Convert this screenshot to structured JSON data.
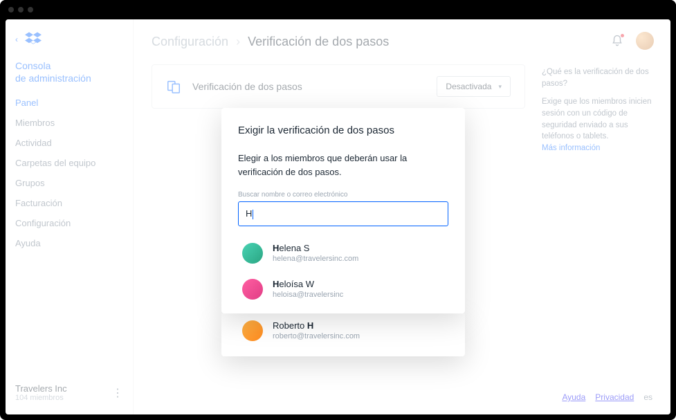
{
  "sidebar": {
    "console_heading_l1": "Consola",
    "console_heading_l2": "de administración",
    "items": [
      "Panel",
      "Miembros",
      "Actividad",
      "Carpetas del equipo",
      "Grupos",
      "Facturación",
      "Configuración",
      "Ayuda"
    ],
    "org_name": "Travelers Inc",
    "org_subtitle": "104 miembros"
  },
  "breadcrumb": {
    "parent": "Configuración",
    "current": "Verificación de dos pasos"
  },
  "card": {
    "title": "Verificación de dos pasos",
    "pill": "Desactivada"
  },
  "info": {
    "question": "¿Qué es la verificación de dos pasos?",
    "body": "Exige que los miembros inicien sesión con un código de seguridad enviado a sus teléfonos o tablets.",
    "link": "Más información"
  },
  "footer": {
    "help": "Ayuda",
    "privacy": "Privacidad",
    "lang": "es"
  },
  "modal": {
    "title": "Exigir la verificación de dos pasos",
    "desc": "Elegir a los miembros que deberán usar la verificación de dos pasos.",
    "search_label": "Buscar nombre o correo electrónico",
    "search_value": "H",
    "suggestions": [
      {
        "name_pre": "H",
        "name_rest": "elena S",
        "email": "helena@travelersinc.com"
      },
      {
        "name_pre": "H",
        "name_rest": "eloísa W",
        "email": "heloisa@travelersinc"
      },
      {
        "name_pre2": "Roberto ",
        "name_hl2": "H",
        "email": "roberto@travelersinc.com"
      }
    ]
  }
}
